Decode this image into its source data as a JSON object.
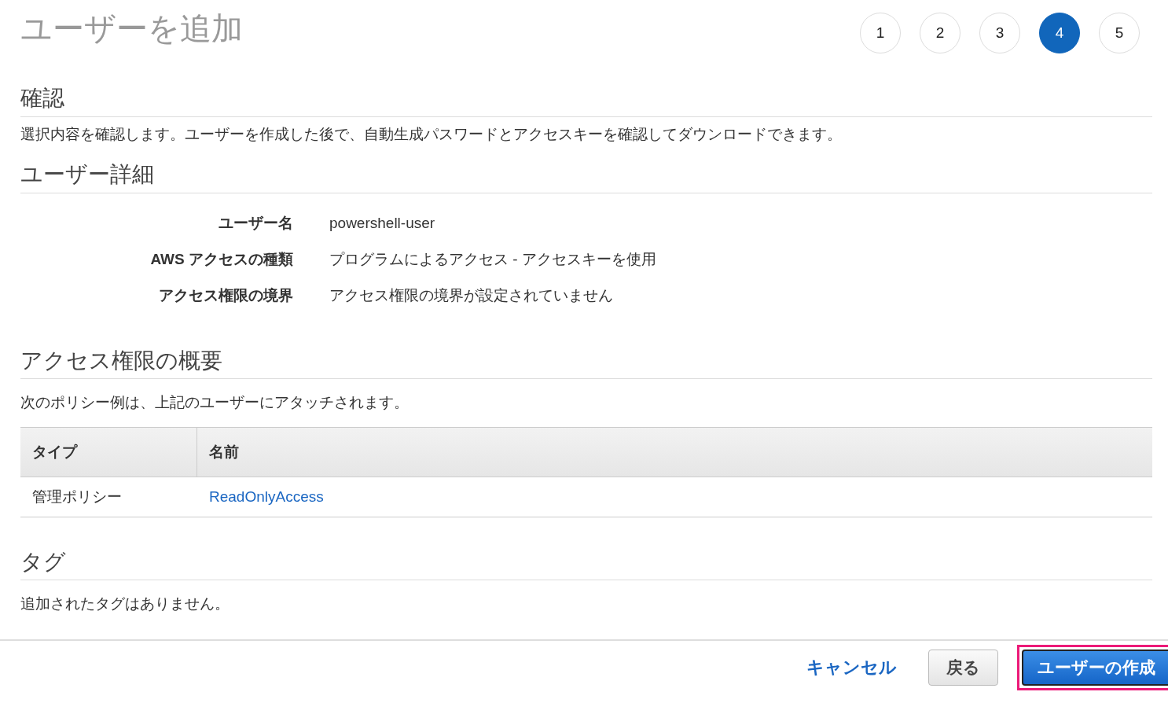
{
  "title": "ユーザーを追加",
  "steps": [
    {
      "label": "1",
      "selected": false
    },
    {
      "label": "2",
      "selected": false
    },
    {
      "label": "3",
      "selected": false
    },
    {
      "label": "4",
      "selected": true
    },
    {
      "label": "5",
      "selected": false
    }
  ],
  "review": {
    "heading": "確認",
    "description": "選択内容を確認します。ユーザーを作成した後で、自動生成パスワードとアクセスキーを確認してダウンロードできます。"
  },
  "user_details": {
    "heading": "ユーザー詳細",
    "fields": [
      {
        "label": "ユーザー名",
        "value": "powershell-user"
      },
      {
        "label": "AWS アクセスの種類",
        "value": "プログラムによるアクセス - アクセスキーを使用"
      },
      {
        "label": "アクセス権限の境界",
        "value": "アクセス権限の境界が設定されていません"
      }
    ]
  },
  "permissions": {
    "heading": "アクセス権限の概要",
    "description": "次のポリシー例は、上記のユーザーにアタッチされます。",
    "table": {
      "columns": [
        "タイプ",
        "名前"
      ],
      "rows": [
        [
          "管理ポリシー",
          "ReadOnlyAccess"
        ]
      ]
    }
  },
  "tags": {
    "heading": "タグ",
    "description": "追加されたタグはありません。"
  },
  "footer": {
    "cancel": "キャンセル",
    "back": "戻る",
    "create": {
      "label": "ユーザーの作成",
      "highlighted": true
    }
  }
}
